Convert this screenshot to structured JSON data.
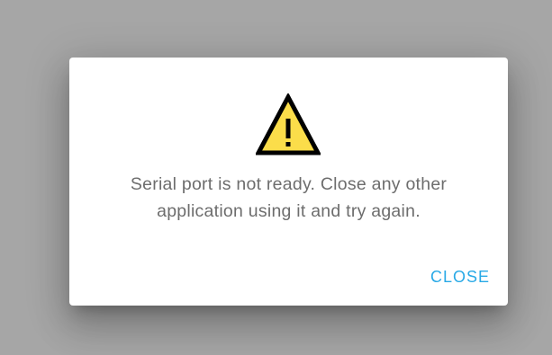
{
  "dialog": {
    "icon": "warning-icon",
    "message": "Serial port is not ready. Close any other application using it and try again.",
    "close_label": "CLOSE",
    "colors": {
      "backdrop": "#a6a6a6",
      "dialog_bg": "#ffffff",
      "message_text": "#6d6d6d",
      "accent": "#29a9e6",
      "warning_fill": "#fbdd4a",
      "warning_stroke": "#000000"
    }
  }
}
